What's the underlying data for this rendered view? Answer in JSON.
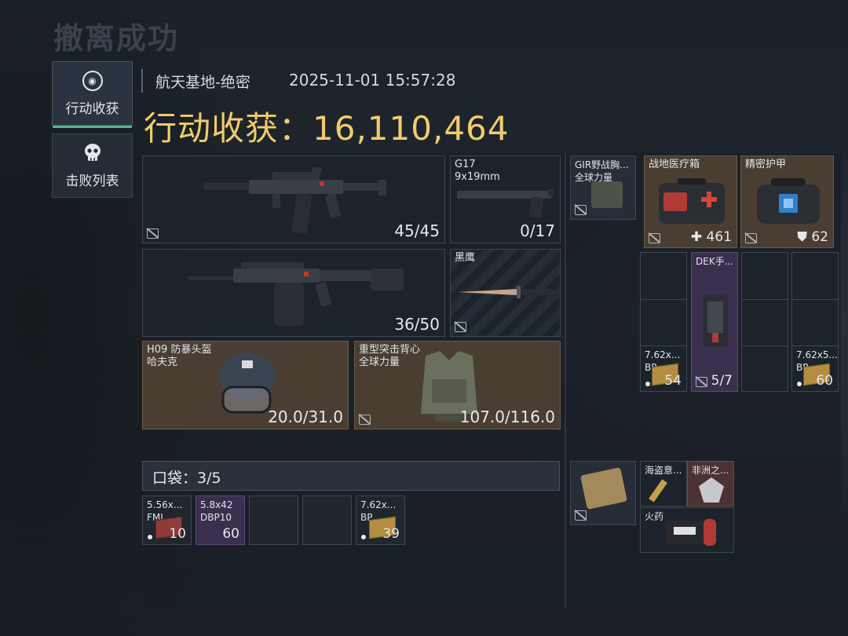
{
  "header": {
    "title": "撤离成功",
    "location": "航天基地-绝密",
    "datetime": "2025-11-01 15:57:28",
    "harvest_label": "行动收获：",
    "harvest_value": "16,110,464"
  },
  "sidebar": {
    "tabs": [
      {
        "label": "行动收获",
        "icon": "target-icon",
        "active": true
      },
      {
        "label": "击败列表",
        "icon": "skull-icon",
        "active": false
      }
    ]
  },
  "loadout": {
    "primary_weapon": {
      "ammo": "45/45"
    },
    "pistol": {
      "name": "G17",
      "caliber": "9x19mm",
      "ammo": "0/17"
    },
    "secondary_weapon": {
      "ammo": "36/50"
    },
    "melee": {
      "name": "黑鹰"
    },
    "helmet": {
      "name": "H09 防暴头盔",
      "brand": "哈夫克",
      "durability": "20.0/31.0"
    },
    "armor": {
      "name": "重型突击背心",
      "brand": "全球力量",
      "durability": "107.0/116.0"
    }
  },
  "pockets": {
    "label": "口袋：",
    "count": "3/5",
    "items": [
      {
        "name": "5.56x...",
        "sub": "FMJ",
        "qty": "10"
      },
      {
        "name": "5.8x42",
        "sub": "DBP10",
        "qty": "60"
      },
      {
        "name": "7.62x...",
        "sub": "BP",
        "qty": "39"
      }
    ]
  },
  "right_gear": {
    "chest_rig": {
      "name": "GIR野战胸...",
      "brand": "全球力量"
    },
    "medkit": {
      "name": "战地医疗箱",
      "value": "461"
    },
    "armor_kit": {
      "name": "精密护甲",
      "value": "62"
    },
    "rig_ammo_left": {
      "name": "7.62x...",
      "sub": "BP",
      "qty": "54"
    },
    "rig_item": {
      "name": "DEK手...",
      "qty": "5/7"
    },
    "rig_ammo_right": {
      "name": "7.62x5...",
      "sub": "BP",
      "qty": "60"
    },
    "backpack_items": [
      {
        "name": "海盗意..."
      },
      {
        "name": "非洲之..."
      },
      {
        "name": "火药"
      }
    ]
  },
  "colors": {
    "gold": "#f0cc6a",
    "accent_green": "#4fb88f",
    "brown_slot": "#4a3e33",
    "purple_slot": "#3a2f4d",
    "red_slot": "#4d3233"
  }
}
